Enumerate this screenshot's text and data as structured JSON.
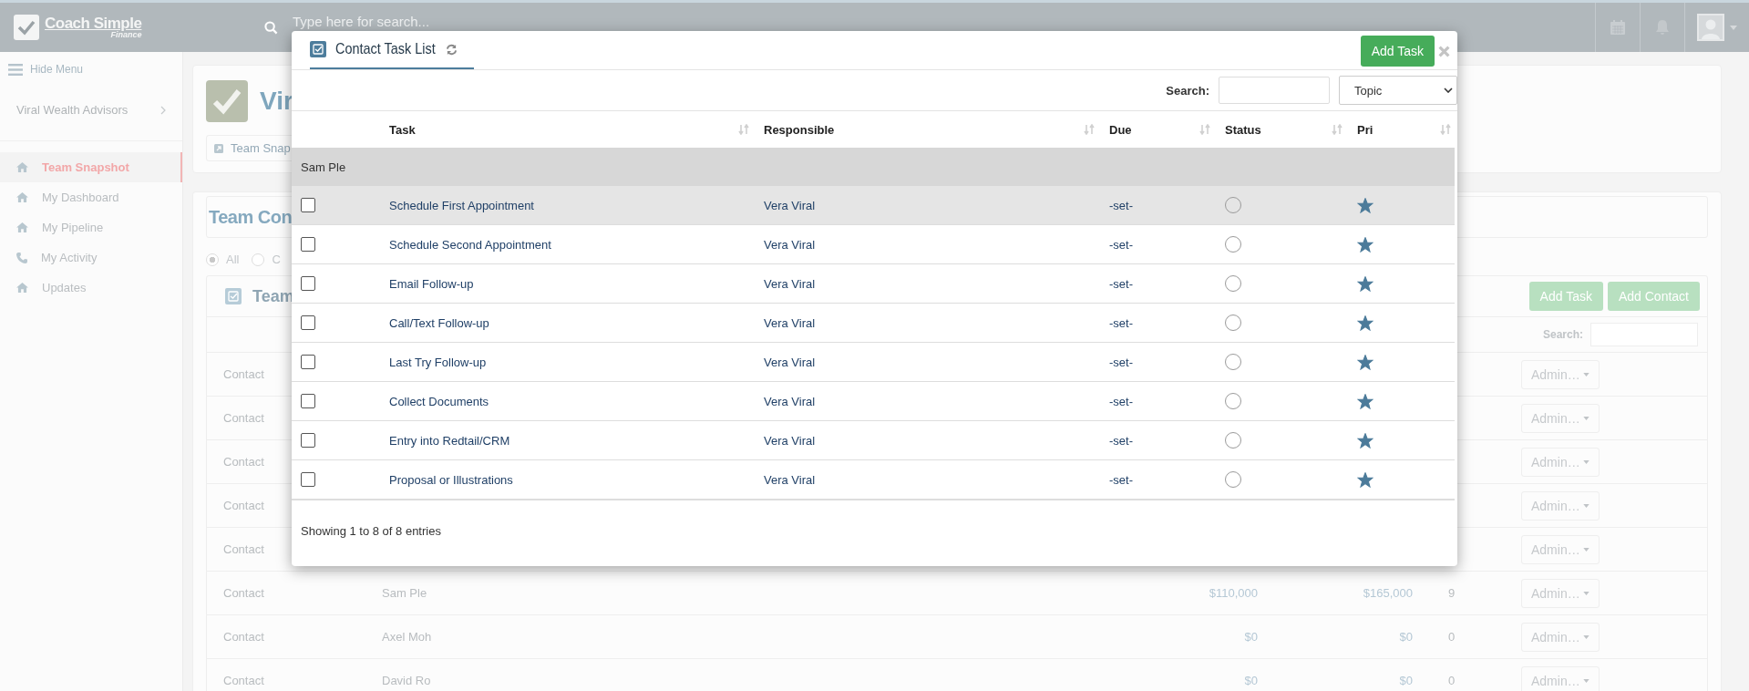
{
  "header": {
    "logo_title": "Coach Simple",
    "logo_subtitle": "Finance",
    "search_placeholder": "Type here for search..."
  },
  "sidebar": {
    "toggle": "Hide Menu",
    "organization": "Viral Wealth Advisors",
    "items": [
      {
        "label": "Team Snapshot",
        "kind": "home",
        "selected": true
      },
      {
        "label": "My Dashboard",
        "kind": "home",
        "selected": false
      },
      {
        "label": "My Pipeline",
        "kind": "home",
        "selected": false
      },
      {
        "label": "My Activity",
        "kind": "phone",
        "selected": false
      },
      {
        "label": "Updates",
        "kind": "home",
        "selected": false
      }
    ]
  },
  "page": {
    "title": "Vir",
    "snapshot_button": "Team Snap",
    "section_title": "Team Con",
    "filters": [
      {
        "label": "All",
        "selected": true
      },
      {
        "label": "C",
        "selected": false
      }
    ],
    "panel_title": "Team",
    "buttons": [
      "Add Task",
      "Add Contact"
    ],
    "search_label": "Search:",
    "rows": [
      {
        "type": "Contact",
        "action": "Admin…"
      },
      {
        "type": "Contact",
        "action": "Admin…"
      },
      {
        "type": "Contact",
        "action": "Admin…"
      },
      {
        "type": "Contact",
        "action": "Admin…"
      },
      {
        "type": "Contact",
        "action": "Admin…"
      },
      {
        "type": "Contact",
        "name": "Sam Ple",
        "amount_1": "$110,000",
        "amount_2": "$165,000",
        "count": "9",
        "action": "Admin…"
      },
      {
        "type": "Contact",
        "name": "Axel Moh",
        "amount_1": "$0",
        "amount_2": "$0",
        "count": "0",
        "action": "Admin…"
      },
      {
        "type": "Contact",
        "name": "David Ro",
        "amount_1": "$0",
        "amount_2": "$0",
        "count": "0",
        "action": "Admin…"
      }
    ]
  },
  "modal": {
    "title": "Contact Task List",
    "add_button": "Add Task",
    "search_label": "Search:",
    "filter_select": "Topic",
    "columns": [
      "Task",
      "Responsible",
      "Due",
      "Status",
      "Pri"
    ],
    "group": "Sam Ple",
    "rows": [
      {
        "task": "Schedule First Appointment",
        "responsible": "Vera Viral",
        "due": "-set-",
        "checked": false,
        "completed": false,
        "starred": true,
        "selected": true
      },
      {
        "task": "Schedule Second Appointment",
        "responsible": "Vera Viral",
        "due": "-set-",
        "checked": false,
        "completed": false,
        "starred": true,
        "selected": false
      },
      {
        "task": "Email Follow-up",
        "responsible": "Vera Viral",
        "due": "-set-",
        "checked": false,
        "completed": false,
        "starred": true,
        "selected": false
      },
      {
        "task": "Call/Text Follow-up",
        "responsible": "Vera Viral",
        "due": "-set-",
        "checked": false,
        "completed": false,
        "starred": true,
        "selected": false
      },
      {
        "task": "Last Try Follow-up",
        "responsible": "Vera Viral",
        "due": "-set-",
        "checked": false,
        "completed": false,
        "starred": true,
        "selected": false
      },
      {
        "task": "Collect Documents",
        "responsible": "Vera Viral",
        "due": "-set-",
        "checked": false,
        "completed": false,
        "starred": true,
        "selected": false
      },
      {
        "task": "Entry into Redtail/CRM",
        "responsible": "Vera Viral",
        "due": "-set-",
        "checked": false,
        "completed": false,
        "starred": true,
        "selected": false
      },
      {
        "task": "Proposal or Illustrations",
        "responsible": "Vera Viral",
        "due": "-set-",
        "checked": false,
        "completed": false,
        "starred": true,
        "selected": false
      }
    ],
    "footer": "Showing 1 to 8 of 8 entries"
  }
}
